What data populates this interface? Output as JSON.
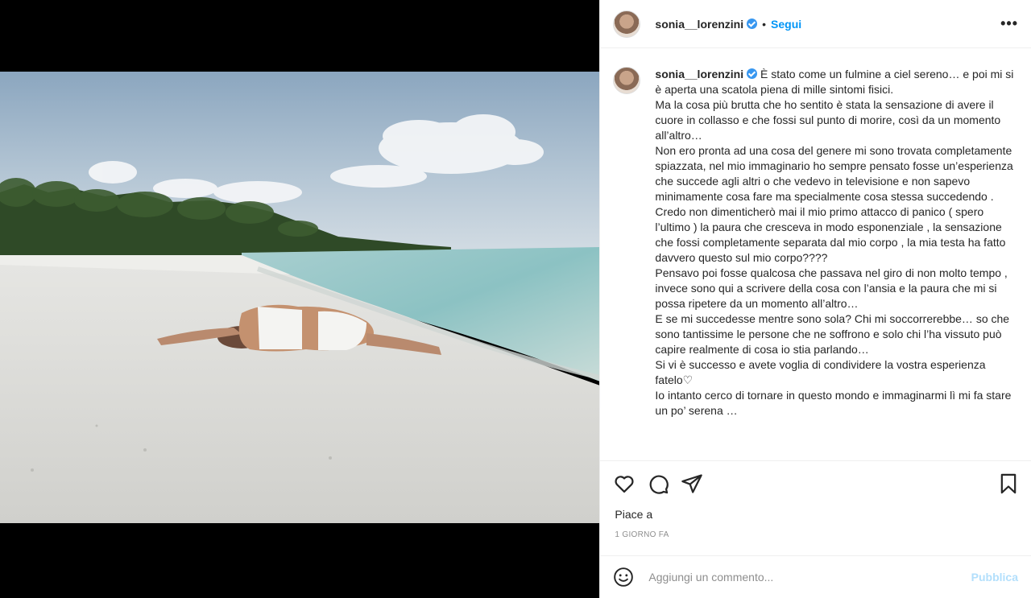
{
  "post": {
    "username": "sonia__lorenzini",
    "verified_icon": "verified-badge-icon",
    "follow_label": "Segui",
    "separator": "•",
    "more_label": "•••",
    "caption_lines": [
      "È stato come un fulmine a ciel sereno… e poi mi si è aperta una scatola piena di mille sintomi fisici.",
      "Ma la cosa più brutta che ho sentito è stata la sensazione di avere il cuore in collasso e che fossi sul punto di morire, così da un momento all’altro…",
      "Non ero pronta ad una cosa del genere mi sono trovata completamente spiazzata, nel mio immaginario ho sempre pensato fosse un’esperienza che succede agli altri o che vedevo in televisione e non sapevo minimamente cosa fare ma specialmente cosa stessa succedendo .",
      "Credo non dimenticherò mai il mio primo attacco di panico ( spero l’ultimo ) la paura che cresceva in modo esponenziale , la sensazione che fossi completamente separata dal mio corpo , la mia testa ha fatto davvero questo sul mio corpo????",
      "Pensavo poi fosse qualcosa che passava nel giro di non molto tempo , invece sono qui a scrivere della cosa con l’ansia e la paura che mi si possa ripetere da un momento all’altro…",
      "E se mi succedesse mentre sono sola? Chi mi soccorrerebbe… so che sono tantissime le persone che ne soffrono e solo chi l’ha vissuto può capire realmente di cosa io stia parlando…",
      "Si vi è successo e avete voglia di condividere la vostra esperienza fatelo♡",
      "Io intanto cerco di tornare in questo mondo e immaginarmi lì mi fa stare un po’ serena …"
    ],
    "likes_label": "Piace a",
    "timestamp": "1 GIORNO FA",
    "comment_placeholder": "Aggiungi un commento...",
    "publish_label": "Pubblica"
  },
  "icons": {
    "like": "heart-icon",
    "comment": "comment-icon",
    "share": "share-icon",
    "save": "bookmark-icon",
    "emoji": "emoji-icon"
  },
  "colors": {
    "accent": "#0095f6",
    "publish_disabled": "#b2dffc",
    "verified": "#3897f0"
  }
}
